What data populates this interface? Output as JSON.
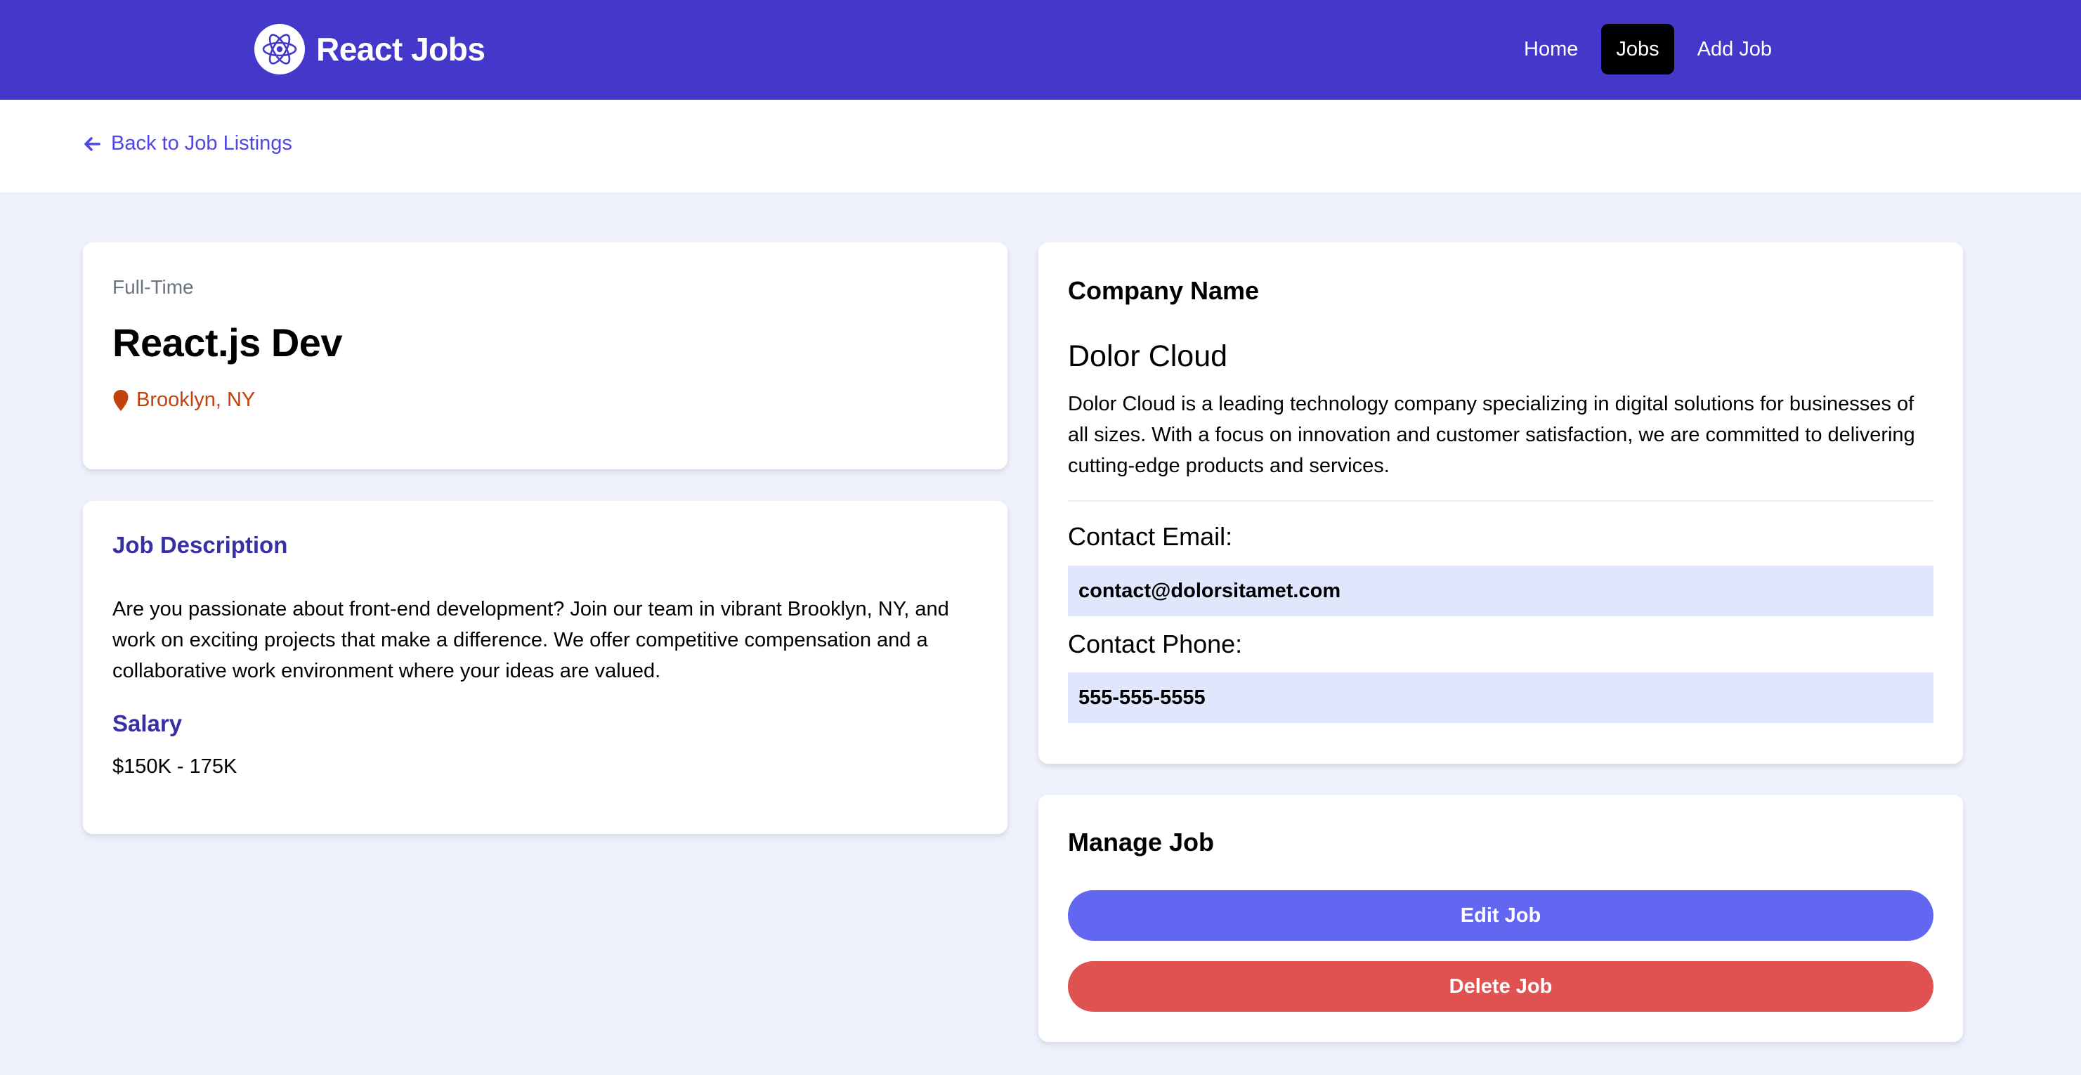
{
  "header": {
    "brand": "React Jobs",
    "nav": [
      {
        "label": "Home",
        "active": false
      },
      {
        "label": "Jobs",
        "active": true
      },
      {
        "label": "Add Job",
        "active": false
      }
    ],
    "bar_color": "#4338ca"
  },
  "back_link": {
    "label": "Back to Job Listings",
    "icon": "arrow-left-icon"
  },
  "job": {
    "type": "Full-Time",
    "title": "React.js Dev",
    "location": "Brooklyn, NY",
    "location_icon": "map-marker-icon",
    "description_heading": "Job Description",
    "description": "Are you passionate about front-end development? Join our team in vibrant Brooklyn, NY, and work on exciting projects that make a difference. We offer competitive compensation and a collaborative work environment where your ideas are valued.",
    "salary_heading": "Salary",
    "salary": "$150K - 175K"
  },
  "company": {
    "heading": "Company Name",
    "name": "Dolor Cloud",
    "description": "Dolor Cloud is a leading technology company specializing in digital solutions for businesses of all sizes. With a focus on innovation and customer satisfaction, we are committed to delivering cutting-edge products and services.",
    "email_label": "Contact Email:",
    "email": "contact@dolorsitamet.com",
    "phone_label": "Contact Phone:",
    "phone": "555-555-5555"
  },
  "manage": {
    "heading": "Manage Job",
    "edit_label": "Edit Job",
    "delete_label": "Delete Job",
    "edit_color": "#6366f1",
    "delete_color": "#e05252"
  }
}
